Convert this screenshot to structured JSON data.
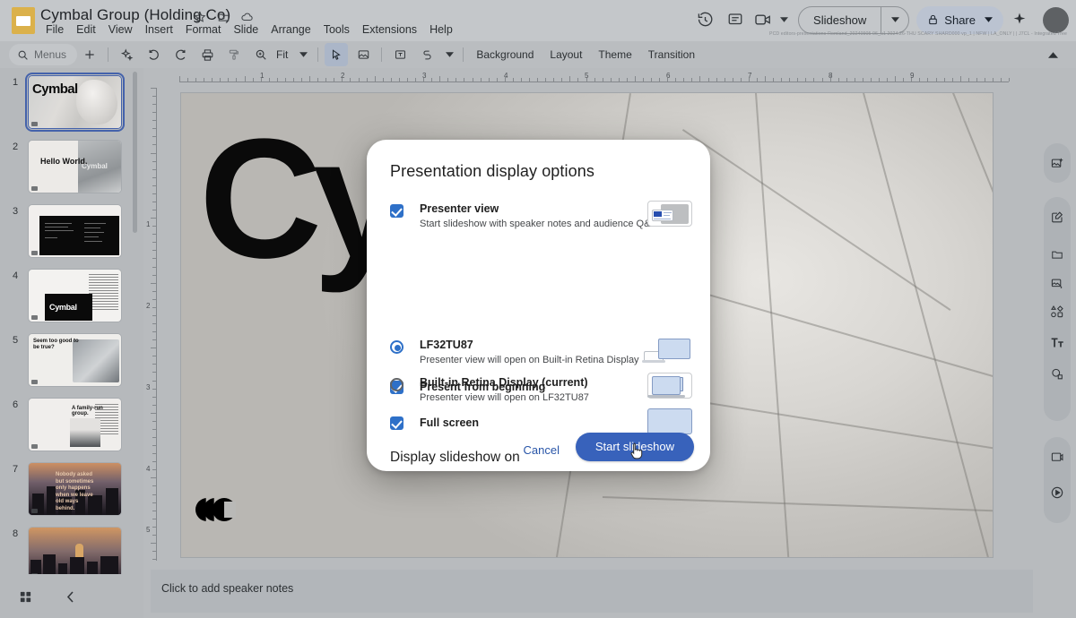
{
  "app": {
    "doc_title": "Cymbal Group (Holding Co)",
    "logo_icon": "slides-logo-icon",
    "title_icons": [
      "star-icon",
      "move-to-folder-icon",
      "cloud-saved-icon"
    ],
    "menus": [
      "File",
      "Edit",
      "View",
      "Insert",
      "Format",
      "Slide",
      "Arrange",
      "Tools",
      "Extensions",
      "Help"
    ],
    "top_right": {
      "history_icon": "version-history-icon",
      "comments_icon": "comment-icon",
      "meet_icon": "present-to-meeting-icon",
      "meet_caret": "chevron-down-icon",
      "slideshow_label": "Slideshow",
      "slideshow_caret": "chevron-down-icon",
      "share_lock_icon": "lock-icon",
      "share_label": "Share",
      "share_caret": "chevron-down-icon",
      "gemini_icon": "gemini-spark-icon",
      "avatar": "avatar"
    },
    "ghost_line": "PCD editors-presentations-Romland_20240905 06_u1 2024.26-THU SCARY SHARD000 vp_1 | NFW | LA_ONLY | | J7CL - Integrated Tree"
  },
  "toolbar": {
    "search_icon": "search-icon",
    "search_placeholder": "Menus",
    "buttons": [
      {
        "name": "new-slide-button",
        "glyph": "+"
      },
      {
        "name": "gemini-image-button",
        "glyph": "spark"
      },
      {
        "name": "undo-button",
        "glyph": "undo"
      },
      {
        "name": "redo-button",
        "glyph": "redo"
      },
      {
        "name": "print-button",
        "glyph": "print"
      },
      {
        "name": "paint-format-button",
        "glyph": "paint"
      },
      {
        "name": "zoom-button",
        "glyph": "zoom"
      }
    ],
    "zoom_label": "Fit",
    "zoom_caret": "chevron-down-icon",
    "select_icon": "cursor-select-icon",
    "image-button": "image-icon",
    "textbox_icon": "text-box-icon",
    "shape_icon": "shape-icon",
    "shape_caret": "chevron-down-icon",
    "text_items": [
      "Background",
      "Layout",
      "Theme",
      "Transition"
    ],
    "collapse_icon": "chevron-up-icon"
  },
  "filmstrip": {
    "slides": [
      {
        "number": "1",
        "art": "t1",
        "title": "Cymbal",
        "selected": true
      },
      {
        "number": "2",
        "art": "t2",
        "title": "Hello World."
      },
      {
        "number": "3",
        "art": "t3",
        "title": ""
      },
      {
        "number": "4",
        "art": "t4",
        "title": "Cymbal"
      },
      {
        "number": "5",
        "art": "t5",
        "title": "Seem too good to be true?"
      },
      {
        "number": "6",
        "art": "t6",
        "title": "A family-run group."
      },
      {
        "number": "7",
        "art": "t7",
        "title": "Nobody asked but sometimes only happens when we leave old ways behind."
      },
      {
        "number": "8",
        "art": "t8",
        "title": ""
      }
    ],
    "grid_view_icon": "grid-view-icon",
    "collapse_icon": "chevron-left-icon"
  },
  "canvas": {
    "slide_text": "Cym",
    "logo_icon": "cymbal-logo-icon",
    "ruler_h_numbers": [
      "1",
      "2",
      "3",
      "4",
      "5",
      "6",
      "7",
      "8",
      "9"
    ],
    "ruler_v_numbers": [
      "1",
      "2",
      "3",
      "4",
      "5"
    ],
    "resize_handle": "canvas-resize-handle"
  },
  "notes": {
    "placeholder": "Click to add speaker notes"
  },
  "right_rail": {
    "buttons": [
      "insert-image-icon",
      "explore-icon",
      "folder-icon",
      "image-placeholder-icon",
      "shapes-icon",
      "text-style-icon",
      "comment-add-icon",
      "record-slideshow-icon",
      "play-icon"
    ]
  },
  "dialog": {
    "title": "Presentation display options",
    "checkboxes": [
      {
        "name": "presenter-view",
        "label": "Presenter view",
        "sublabel": "Start slideshow with speaker notes and audience Q&A",
        "checked": true,
        "preview": "presenter-view-preview-icon"
      },
      {
        "name": "present-from-beginning",
        "label": "Present from beginning",
        "sublabel": "",
        "checked": true,
        "preview": "present-from-beginning-preview-icon"
      },
      {
        "name": "full-screen",
        "label": "Full screen",
        "sublabel": "",
        "checked": true,
        "preview": "full-screen-preview-icon"
      }
    ],
    "section_title": "Display slideshow on",
    "radios": [
      {
        "name": "display-lf32tu87",
        "label": "LF32TU87",
        "sublabel": "Presenter view will open on Built-in Retina Display",
        "selected": true,
        "preview": "external-monitor-icon"
      },
      {
        "name": "display-builtin-retina",
        "label": "Built-in Retina Display (current)",
        "sublabel": "Presenter view will open on LF32TU87",
        "selected": false,
        "preview": "laptop-icon"
      }
    ],
    "cancel_label": "Cancel",
    "start_label": "Start slideshow",
    "accent_color": "#1a73e8",
    "primary_button_color": "#2b63d9"
  }
}
